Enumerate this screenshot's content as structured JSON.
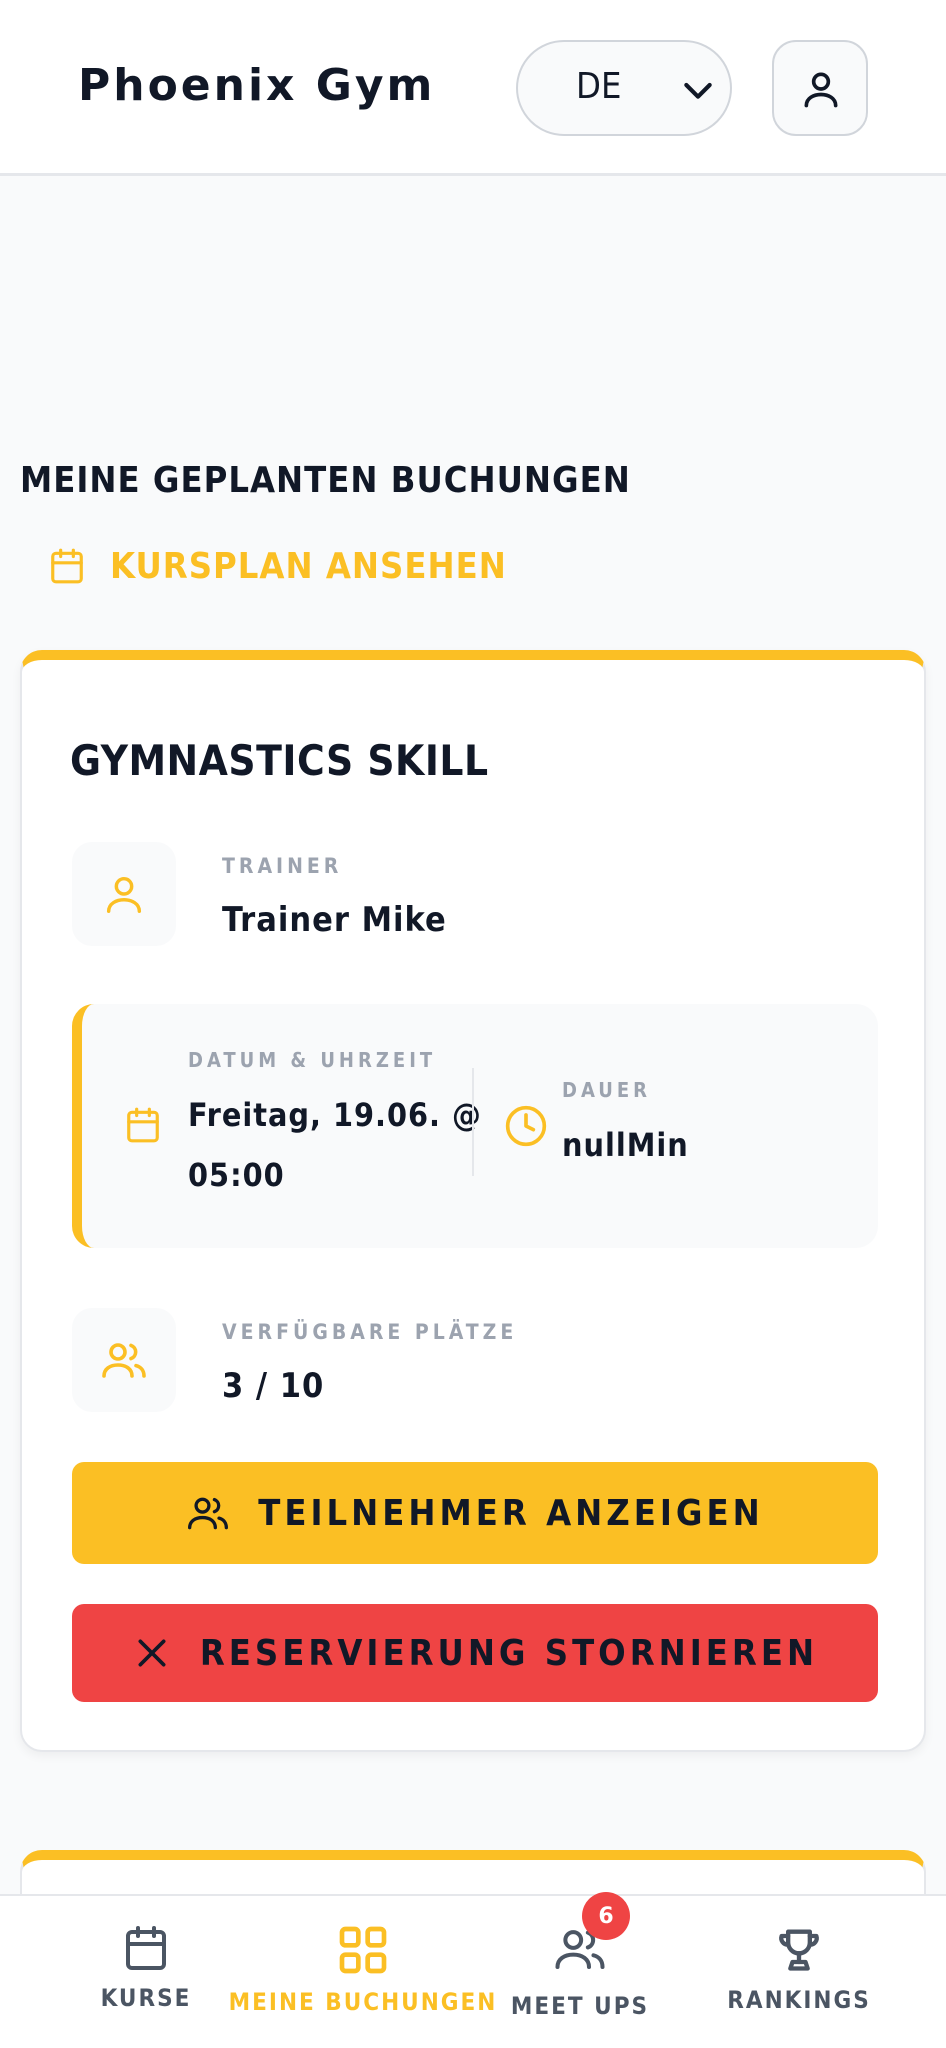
{
  "header": {
    "brand": "Phoenix Gym",
    "language": "DE"
  },
  "main": {
    "section_title": "MEINE GEPLANTEN BUCHUNGEN",
    "schedule_link": "KURSPLAN ANSEHEN"
  },
  "booking": {
    "title": "GYMNASTICS SKILL",
    "trainer_label": "TRAINER",
    "trainer_value": "Trainer Mike",
    "datetime_label": "DATUM & UHRZEIT",
    "datetime_line1": "Freitag, 19.06. @",
    "datetime_line2": "05:00",
    "duration_label": "DAUER",
    "duration_value": "nullMin",
    "slots_label": "VERFÜGBARE PLÄTZE",
    "slots_value": "3 / 10",
    "participants_button": "TEILNEHMER ANZEIGEN",
    "cancel_button": "RESERVIERUNG STORNIEREN"
  },
  "nav": {
    "items": [
      {
        "label": "KURSE",
        "icon": "calendar-icon"
      },
      {
        "label": "MEINE BUCHUNGEN",
        "icon": "grid-icon"
      },
      {
        "label": "MEET UPS",
        "icon": "users-icon"
      },
      {
        "label": "RANKINGS",
        "icon": "trophy-icon"
      }
    ],
    "meetups_badge": "6"
  },
  "colors": {
    "accent": "#fbbf24",
    "danger": "#ef4444",
    "text": "#111827",
    "muted": "#9ca3af"
  }
}
